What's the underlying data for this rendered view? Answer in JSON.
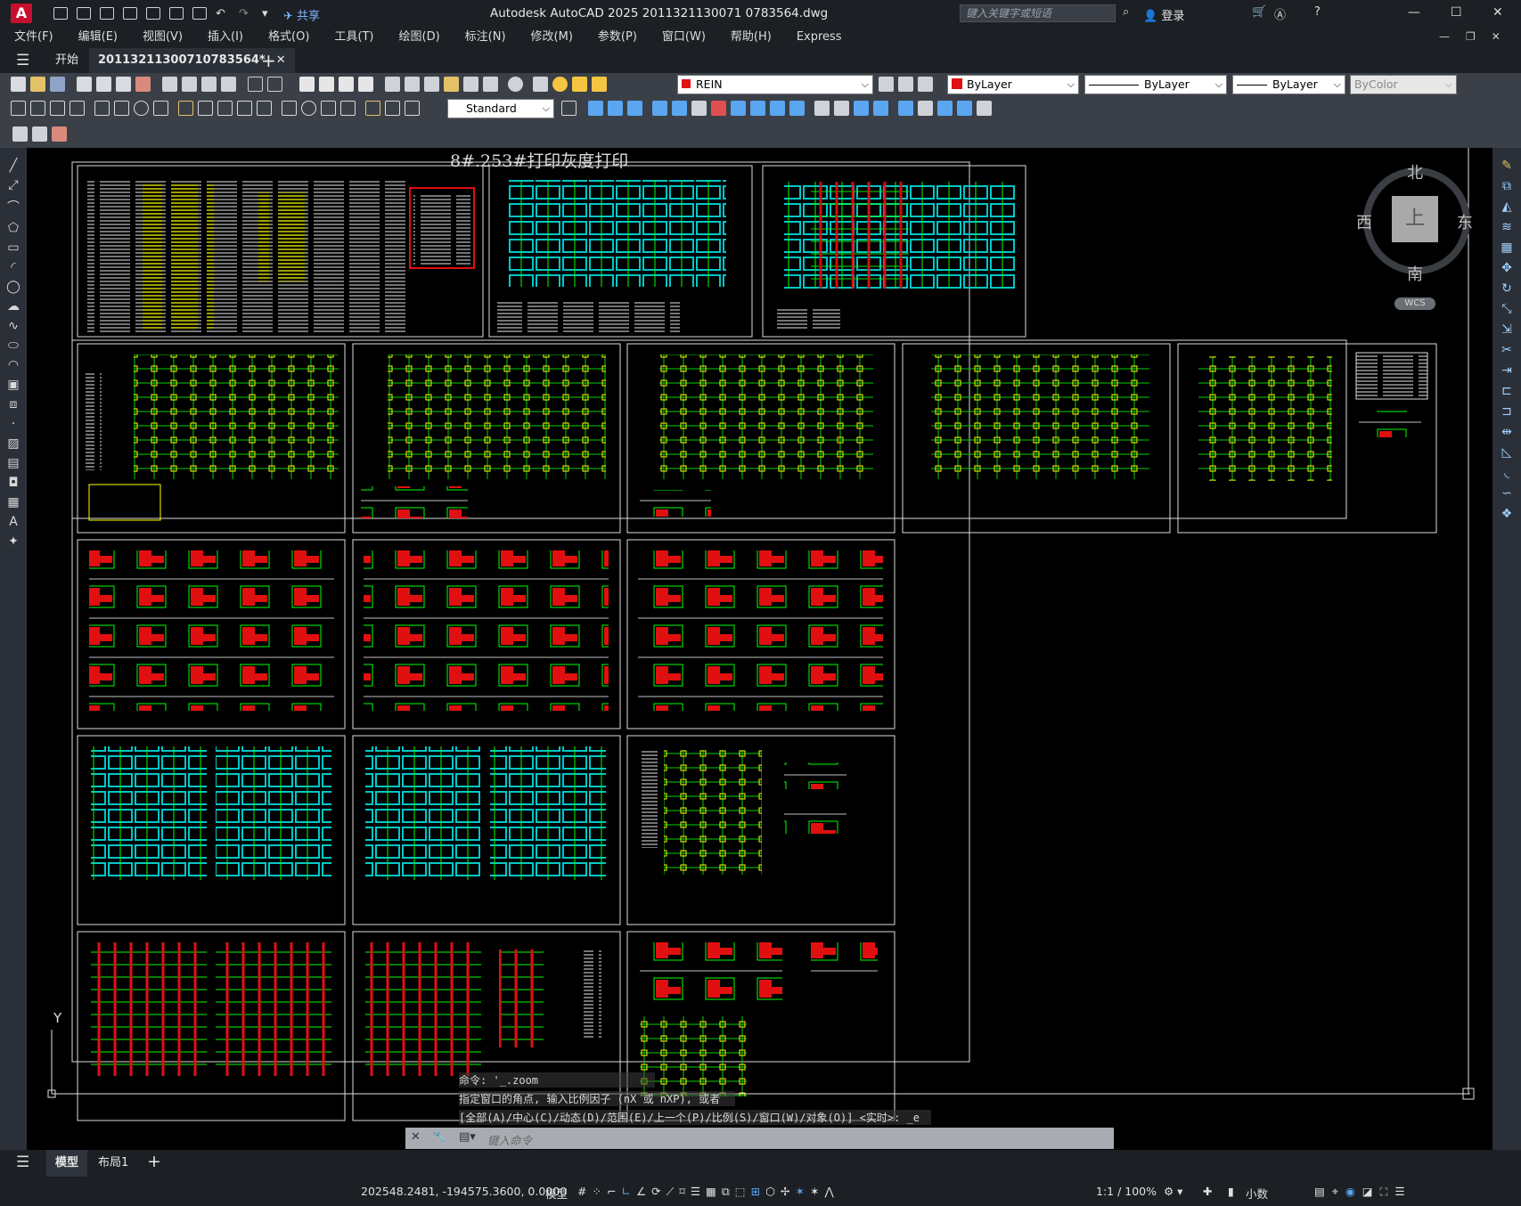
{
  "app": {
    "logo_letter": "A",
    "title": "Autodesk AutoCAD 2025    2011321130071 0783564.dwg",
    "share_label": "共享",
    "search_placeholder": "键入关键字或短语",
    "login_label": "登录"
  },
  "menu": [
    "文件(F)",
    "编辑(E)",
    "视图(V)",
    "插入(I)",
    "格式(O)",
    "工具(T)",
    "绘图(D)",
    "标注(N)",
    "修改(M)",
    "参数(P)",
    "窗口(W)",
    "帮助(H)",
    "Express"
  ],
  "tabs": {
    "start": "开始",
    "file": "20113211300710783564*"
  },
  "toolbar": {
    "layer_name": "REIN",
    "color": "ByLayer",
    "linetype": "ByLayer",
    "lineweight": "ByLayer",
    "plotstyle": "ByColor",
    "textstyle": "Standard"
  },
  "drawing": {
    "header_text": "8#.253#打印灰度打印",
    "viewcube": {
      "north": "北",
      "south": "南",
      "east": "东",
      "west": "西",
      "top": "上",
      "wcs": "WCS"
    },
    "ucs_y": "Y"
  },
  "command": {
    "line1": "命令: '_.zoom",
    "line2": "指定窗口的角点, 输入比例因子 (nX 或 nXP), 或者",
    "line3": "[全部(A)/中心(C)/动态(D)/范围(E)/上一个(P)/比例(S)/窗口(W)/对象(O)] <实时>: _e",
    "placeholder": "键入命令"
  },
  "layouts": {
    "model": "模型",
    "layout1": "布局1"
  },
  "status": {
    "coords": "202548.2481, -194575.3600, 0.0000",
    "mode": "模型",
    "scale": "1:1 / 100%",
    "units": "小数"
  },
  "colors": {
    "accent_red": "#e01010",
    "cad_green": "#00ff00",
    "cad_cyan": "#00c8c8",
    "cad_yellow": "#ffff00"
  }
}
